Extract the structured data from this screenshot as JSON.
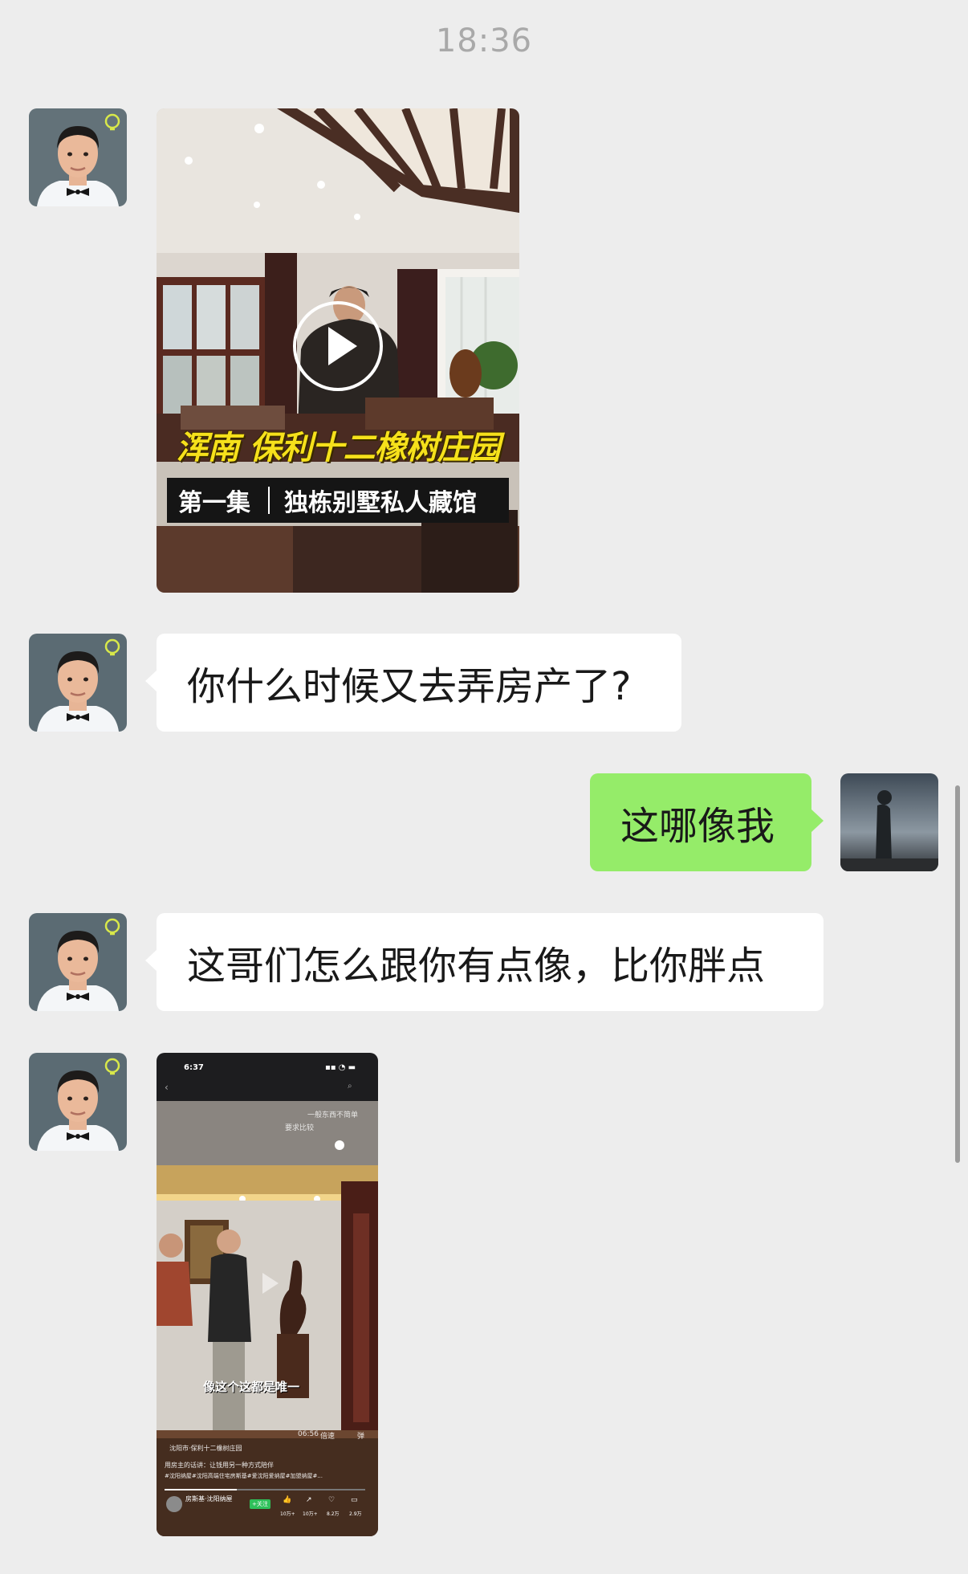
{
  "timestamp": "18:36",
  "messages": [
    {
      "type": "video",
      "side": "left",
      "title_overlay": "浑南 保利十二橡树庄园",
      "subtitle_left": "第一集",
      "subtitle_right": "独栋别墅私人藏馆"
    },
    {
      "type": "text",
      "side": "left",
      "text": "你什么时候又去弄房产了?"
    },
    {
      "type": "text",
      "side": "right",
      "text": "这哪像我"
    },
    {
      "type": "text",
      "side": "left",
      "text": "这哥们怎么跟你有点像，比你胖点"
    },
    {
      "type": "video",
      "side": "left",
      "status_time": "6:37",
      "top_caption_1": "一般东西不简单",
      "top_caption_2": "要求比较",
      "subtitle": "像这个这都是唯一",
      "duration": "06:56",
      "speed": "倍速",
      "danmu": "弹",
      "location": "沈阳市·保利十二橡树庄园",
      "desc": "用房主的话讲：让钱用另一种方式陪伴",
      "tags": "#沈阳纳屋#沈阳高端住宅房斯基#爱沈阳爱纳屋#加盟纳屋#...",
      "author": "房斯基·沈阳纳屋",
      "follow": "+关注",
      "stats": [
        "10万+",
        "10万+",
        "8.2万",
        "2.9万"
      ]
    }
  ]
}
